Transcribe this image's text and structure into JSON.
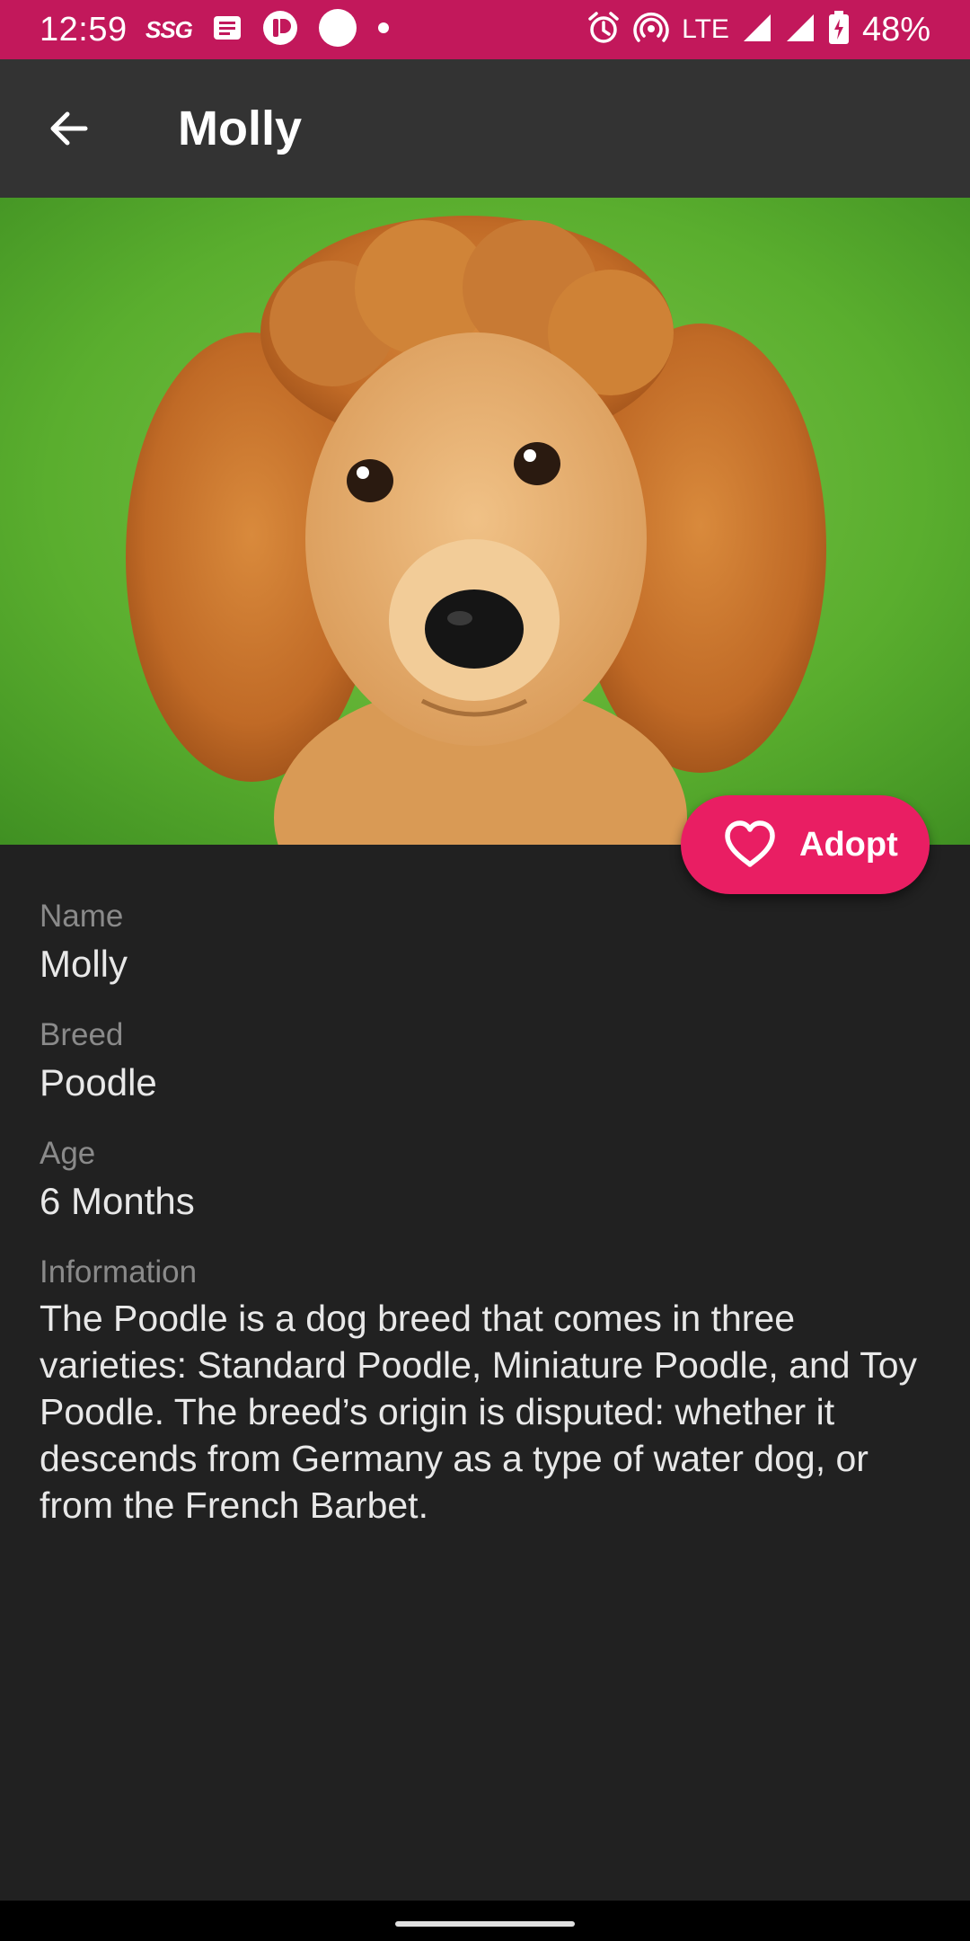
{
  "status_bar": {
    "time": "12:59",
    "carrier_badge": "SSG",
    "network": "LTE",
    "battery": "48%",
    "color": "#c2185b"
  },
  "app_bar": {
    "title": "Molly",
    "back_icon": "arrow-left-icon"
  },
  "hero": {
    "subject": "poodle-photo"
  },
  "adopt_button": {
    "label": "Adopt",
    "icon": "heart-outline-icon",
    "color": "#e91e63"
  },
  "details": {
    "name_label": "Name",
    "name_value": "Molly",
    "breed_label": "Breed",
    "breed_value": "Poodle",
    "age_label": "Age",
    "age_value": "6 Months",
    "info_label": "Information",
    "info_value": "The Poodle is a dog breed that comes in three varieties: Standard Poodle, Miniature Poodle, and Toy Poodle. The breed’s origin is disputed: whether it descends from Germany as a type of water dog, or from the French Barbet."
  }
}
